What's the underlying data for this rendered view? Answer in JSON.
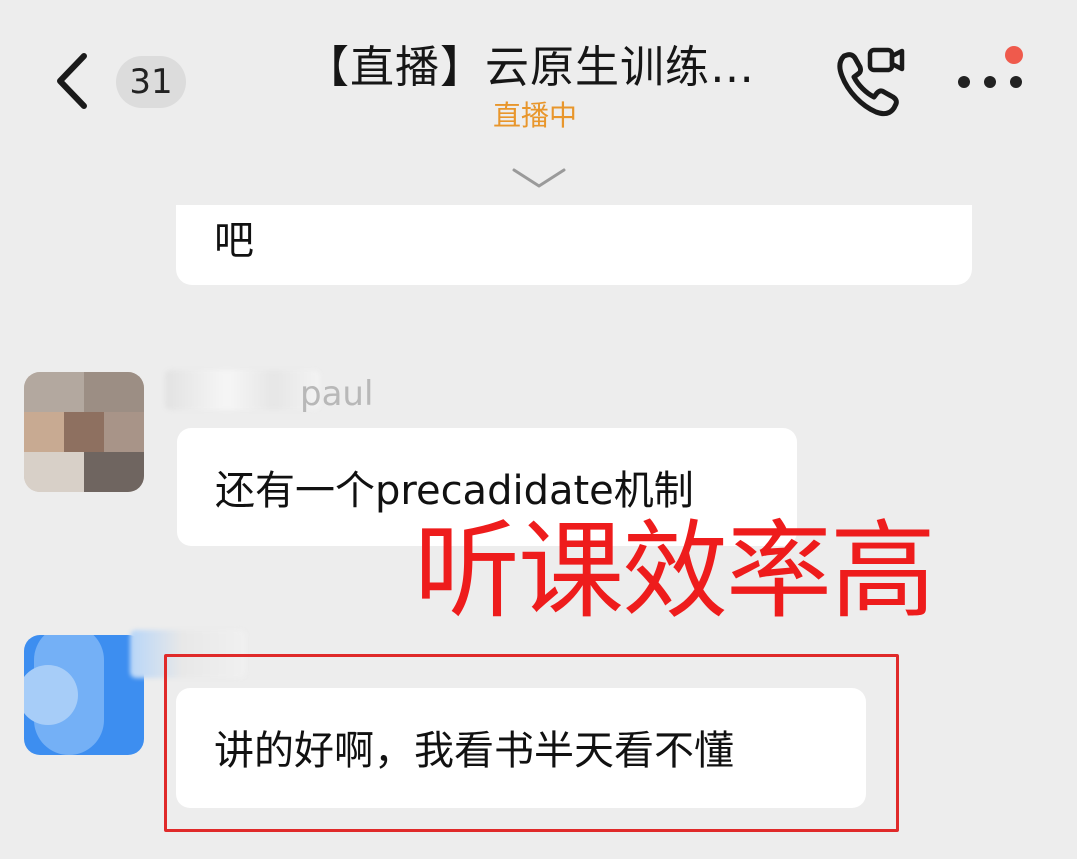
{
  "header": {
    "back_icon": "chevron-left-icon",
    "unread_count": "31",
    "title": "【直播】云原生训练…",
    "status": "直播中",
    "call_icon": "phone-video-icon",
    "more_icon": "more-dots-icon",
    "collapse_icon": "chevron-down-icon"
  },
  "messages": [
    {
      "type": "received",
      "text": "吧"
    },
    {
      "type": "received",
      "sender_partial": "paul",
      "text": "还有一个precadidate机制"
    },
    {
      "type": "received",
      "text": "讲的好啊，我看书半天看不懂"
    }
  ],
  "overlay": {
    "caption": "听课效率高",
    "caption_color": "#ee1c1c",
    "box_color": "#e02a2a"
  },
  "colors": {
    "background": "#ededed",
    "bubble": "#ffffff",
    "status": "#e8962c",
    "notify_dot": "#ef5a4c"
  }
}
